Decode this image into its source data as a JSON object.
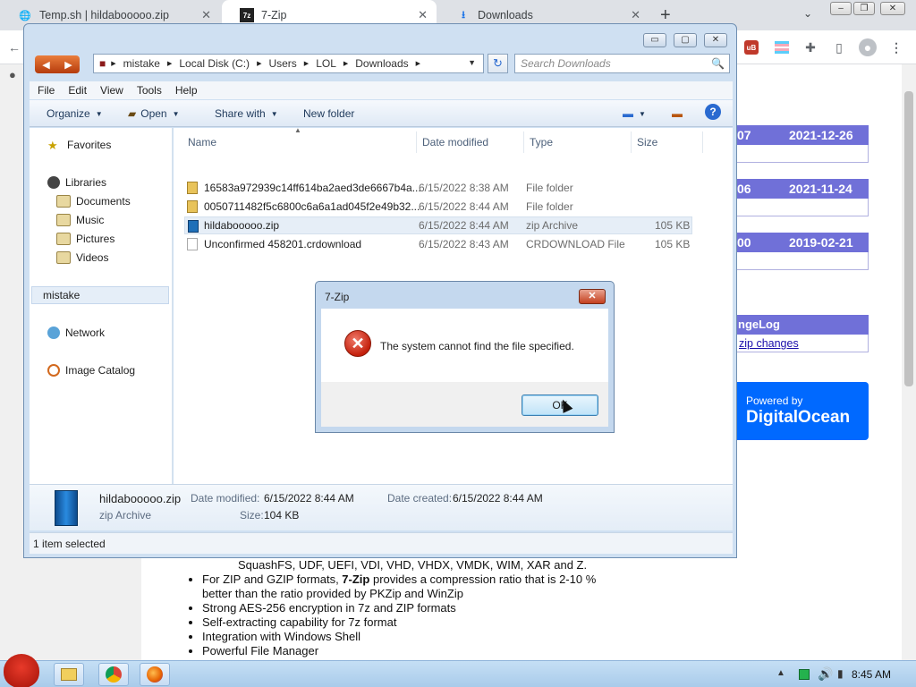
{
  "browser": {
    "tabs": [
      {
        "label": "Temp.sh | hildabooooo.zip",
        "close": "✕"
      },
      {
        "label": "7-Zip",
        "close": "✕"
      },
      {
        "label": "Downloads",
        "close": "✕"
      }
    ],
    "new_tab": "+",
    "tab_search": "⌄",
    "window_controls": {
      "minimize": "‒",
      "restore": "❐",
      "close": "✕"
    }
  },
  "page": {
    "versions": [
      {
        "num": "07",
        "date": "2021-12-26"
      },
      {
        "num": "06",
        "date": "2021-11-24"
      },
      {
        "num": "00",
        "date": "2019-02-21"
      }
    ],
    "changelog_title": "ngeLog",
    "changelog_link": "zip changes",
    "sponsor": {
      "line1": "Powered by",
      "line2": "DigitalOcean"
    },
    "features": {
      "continued": "SquashFS, UDF, UEFI, VDI, VHD, VHDX, VMDK, WIM, XAR and Z.",
      "zip_prefix": "For ZIP and GZIP formats, ",
      "zip_bold": "7-Zip",
      "zip_suffix": " provides a compression ratio that is 2-10 %",
      "zip_line2": "better than the ratio provided by PKZip and WinZip",
      "items": [
        "Strong AES-256 encryption in 7z and ZIP formats",
        "Self-extracting capability for 7z format",
        "Integration with Windows Shell",
        "Powerful File Manager"
      ]
    }
  },
  "explorer": {
    "window_controls": {
      "minimize": "▭",
      "maximize": "▢",
      "close": "✕"
    },
    "breadcrumb": [
      "mistake",
      "Local Disk (C:)",
      "Users",
      "LOL",
      "Downloads"
    ],
    "search_placeholder": "Search Downloads",
    "menu": [
      "File",
      "Edit",
      "View",
      "Tools",
      "Help"
    ],
    "commands": {
      "organize": "Organize",
      "open": "Open",
      "share": "Share with",
      "new_folder": "New folder"
    },
    "nav": {
      "favorites": "Favorites",
      "libraries": "Libraries",
      "documents": "Documents",
      "music": "Music",
      "pictures": "Pictures",
      "videos": "Videos",
      "mistake": "mistake",
      "network": "Network",
      "image_catalog": "Image Catalog"
    },
    "columns": {
      "name": "Name",
      "date": "Date modified",
      "type": "Type",
      "size": "Size"
    },
    "files": [
      {
        "name": "16583a972939c14ff614ba2aed3de6667b4a...",
        "date": "6/15/2022 8:38 AM",
        "type": "File folder",
        "size": ""
      },
      {
        "name": "0050711482f5c6800c6a6a1ad045f2e49b32...",
        "date": "6/15/2022 8:44 AM",
        "type": "File folder",
        "size": ""
      },
      {
        "name": "hildabooooo.zip",
        "date": "6/15/2022 8:44 AM",
        "type": "zip Archive",
        "size": "105 KB"
      },
      {
        "name": "Unconfirmed 458201.crdownload",
        "date": "6/15/2022 8:43 AM",
        "type": "CRDOWNLOAD File",
        "size": "105 KB"
      }
    ],
    "details": {
      "filename": "hildabooooo.zip",
      "filetype": "zip Archive",
      "modified_label": "Date modified:",
      "modified_value": "6/15/2022 8:44 AM",
      "created_label": "Date created:",
      "created_value": "6/15/2022 8:44 AM",
      "size_label": "Size:",
      "size_value": "104 KB"
    },
    "status": "1 item selected"
  },
  "dialog": {
    "title": "7-Zip",
    "close": "✕",
    "message": "The system cannot find the file specified.",
    "ok": "OK"
  },
  "taskbar": {
    "time": "8:45 AM"
  }
}
